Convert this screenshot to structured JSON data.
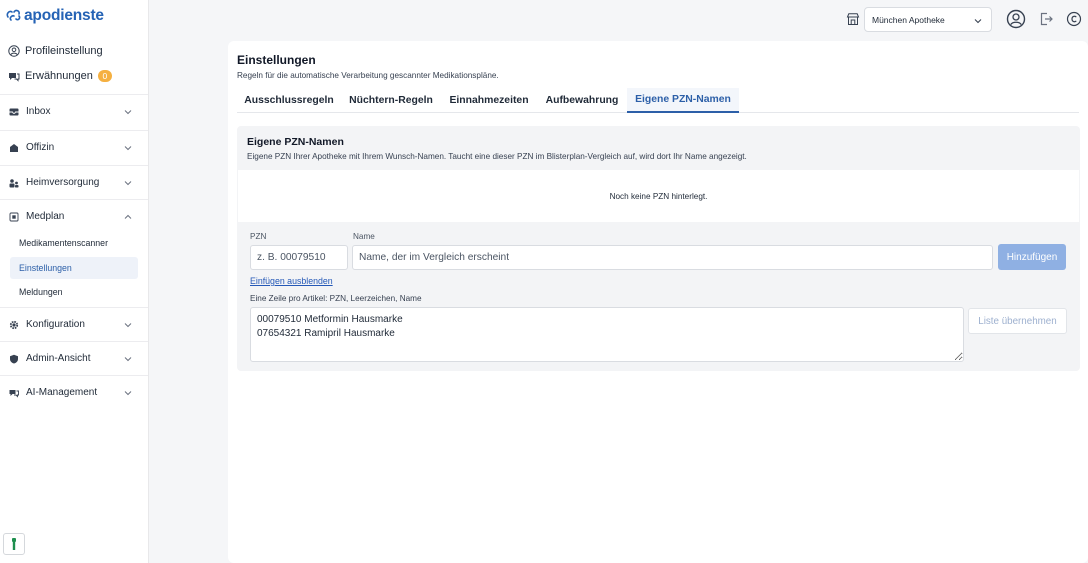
{
  "app": {
    "logo_text": "apodienste"
  },
  "sidebar": {
    "profile_label": "Profileinstellung",
    "mentions_label": "Erwähnungen",
    "mentions_count": "0",
    "nav": [
      {
        "label": "Inbox"
      },
      {
        "label": "Offizin"
      },
      {
        "label": "Heimversorgung"
      },
      {
        "label": "Medplan"
      },
      {
        "label": "Konfiguration"
      },
      {
        "label": "Admin-Ansicht"
      },
      {
        "label": "AI-Management"
      }
    ],
    "medplan_sub": [
      {
        "label": "Medikamentenscanner"
      },
      {
        "label": "Einstellungen",
        "active": true
      },
      {
        "label": "Meldungen"
      }
    ]
  },
  "header": {
    "pharmacy_select": "München Apotheke"
  },
  "page": {
    "title": "Einstellungen",
    "subtitle": "Regeln für die automatische Verarbeitung gescannter Medikationspläne.",
    "tabs": [
      {
        "label": "Ausschlussregeln"
      },
      {
        "label": "Nüchtern-Regeln"
      },
      {
        "label": "Einnahmezeiten"
      },
      {
        "label": "Aufbewahrung"
      },
      {
        "label": "Eigene PZN-Namen",
        "active": true
      }
    ]
  },
  "pzn": {
    "title": "Eigene PZN-Namen",
    "description": "Eigene PZN Ihrer Apotheke mit Ihrem Wunsch-Namen. Taucht eine dieser PZN im Blisterplan-Vergleich auf, wird dort Ihr Name angezeigt.",
    "empty_text": "Noch keine PZN hinterlegt.",
    "pzn_label": "PZN",
    "pzn_placeholder": "z. B. 00079510",
    "name_label": "Name",
    "name_placeholder": "Name, der im Vergleich erscheint",
    "add_button": "Hinzufügen",
    "toggle_link": "Einfügen ausblenden",
    "bulk_hint": "Eine Zeile pro Artikel: PZN, Leerzeichen, Name",
    "bulk_value": "00079510 Metformin Hausmarke\n07654321 Ramipril Hausmarke",
    "apply_button": "Liste übernehmen"
  },
  "colors": {
    "accent": "#2c5fa8",
    "brand": "#2563b5",
    "badge": "#f5b041",
    "primary_button": "#8fb0e3"
  }
}
